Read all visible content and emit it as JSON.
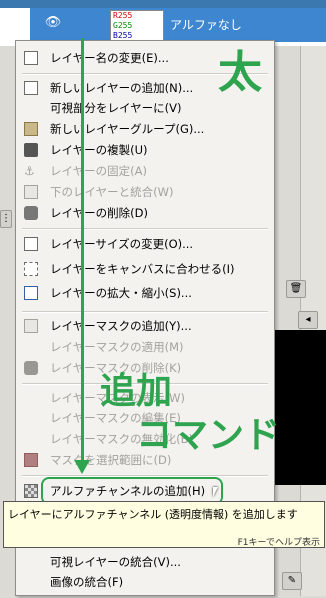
{
  "layer": {
    "name": "アルファなし",
    "thumb_lines": [
      "R255",
      "G255",
      "B255"
    ]
  },
  "menu": {
    "items": [
      {
        "label": "レイヤー名の変更(E)...",
        "icon": "edit-icon",
        "enabled": true
      },
      {
        "label": "新しいレイヤーの追加(N)...",
        "icon": "new-layer-icon",
        "enabled": true
      },
      {
        "label": "可視部分をレイヤーに(V)",
        "icon": "",
        "enabled": true
      },
      {
        "label": "新しいレイヤーグループ(G)...",
        "icon": "folder-icon",
        "enabled": true
      },
      {
        "label": "レイヤーの複製(U)",
        "icon": "duplicate-icon",
        "enabled": true
      },
      {
        "label": "レイヤーの固定(A)",
        "icon": "anchor-icon",
        "enabled": false
      },
      {
        "label": "下のレイヤーと統合(W)",
        "icon": "merge-down-icon",
        "enabled": false
      },
      {
        "label": "レイヤーの削除(D)",
        "icon": "trash-icon",
        "enabled": true
      },
      {
        "label": "レイヤーサイズの変更(O)...",
        "icon": "resize-icon",
        "enabled": true
      },
      {
        "label": "レイヤーをキャンバスに合わせる(I)",
        "icon": "fit-canvas-icon",
        "enabled": true
      },
      {
        "label": "レイヤーの拡大・縮小(S)...",
        "icon": "scale-icon",
        "enabled": true
      },
      {
        "label": "レイヤーマスクの追加(Y)...",
        "icon": "add-mask-icon",
        "enabled": true
      },
      {
        "label": "レイヤーマスクの適用(M)",
        "icon": "",
        "enabled": false
      },
      {
        "label": "レイヤーマスクの削除(K)",
        "icon": "trash-icon",
        "enabled": false
      },
      {
        "label": "レイヤーマスクの表示(W)",
        "icon": "",
        "enabled": false
      },
      {
        "label": "レイヤーマスクの編集(E)",
        "icon": "",
        "enabled": false
      },
      {
        "label": "レイヤーマスクの無効化(B)",
        "icon": "",
        "enabled": false
      },
      {
        "label": "マスクを選択範囲に(D)",
        "icon": "mask-select-icon",
        "enabled": false
      },
      {
        "label": "アルファチャンネルの追加(H)",
        "icon": "alpha-icon",
        "enabled": true
      },
      {
        "label": "可視レイヤーの統合(V)...",
        "icon": "",
        "enabled": true
      },
      {
        "label": "画像の統合(F)",
        "icon": "",
        "enabled": true
      }
    ]
  },
  "annotations": {
    "thick": "太",
    "add": "追加",
    "command": "コマンド"
  },
  "tooltip": {
    "text": "レイヤーにアルファチャンネル (透明度情報) を追加します",
    "help": "F1キーでヘルプ表示"
  },
  "colors": {
    "highlight": "#2ea44f",
    "selection": "#3f86d0"
  }
}
